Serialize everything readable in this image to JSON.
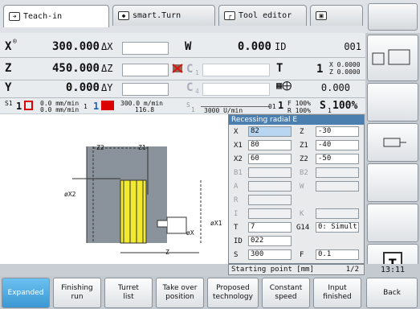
{
  "tabs": [
    {
      "label": "Teach-in",
      "icon": "arrow-right-icon"
    },
    {
      "label": "smart.Turn",
      "icon": "diamond-arrow-icon"
    },
    {
      "label": "Tool editor",
      "icon": "tool-icon"
    },
    {
      "label": "",
      "icon": "floppy-icon"
    }
  ],
  "positions": {
    "x": {
      "axis": "X",
      "value": "300.000",
      "delta": "ΔX"
    },
    "z": {
      "axis": "Z",
      "value": "450.000",
      "delta": "ΔZ"
    },
    "y": {
      "axis": "Y",
      "value": "0.000",
      "delta": "ΔY"
    },
    "w": {
      "axis": "W",
      "value": "0.000",
      "id_label": "ID",
      "id_value": "001"
    },
    "c1": "C",
    "c1_sub": "1",
    "c4": "C",
    "c4_sub": "4",
    "t_label": "T",
    "t_value": "1",
    "t_x": "X 0.0000",
    "t_z": "Z 0.0000",
    "spindle_pos": "0.000"
  },
  "feeds": {
    "s1_label": "S1",
    "s1_num": "1",
    "f1_line1": "0.0 mm/min",
    "f1_line2": "0.0 mm/min",
    "ch_num": "1",
    "ch_num2": "1",
    "f2_line1": "300.0 m/min",
    "f2_line2": "116.8",
    "s_small": "S",
    "s_small_sub": "1",
    "rpm": "3000 U/min",
    "gear": "01",
    "f_pct1": "F 100%",
    "r_pct": "R 100%",
    "s_label": "S",
    "s_sub": "1",
    "s_pct": "100%"
  },
  "dialog": {
    "title": "Recessing radial E",
    "fields": [
      {
        "l1": "X",
        "v1": "82",
        "l2": "Z",
        "v2": "-30"
      },
      {
        "l1": "X1",
        "v1": "80",
        "l2": "Z1",
        "v2": "-40"
      },
      {
        "l1": "X2",
        "v1": "60",
        "l2": "Z2",
        "v2": "-50"
      },
      {
        "l1": "B1",
        "v1": "",
        "l2": "B2",
        "v2": ""
      },
      {
        "l1": "A",
        "v1": "",
        "l2": "W",
        "v2": ""
      },
      {
        "l1": "R",
        "v1": ""
      },
      {
        "l1": "I",
        "v1": "",
        "l2": "K",
        "v2": ""
      },
      {
        "l1": "T",
        "v1": "7",
        "l2": "G14",
        "v2": "0: Simult"
      },
      {
        "l1": "ID",
        "v1": "022"
      },
      {
        "l1": "S",
        "v1": "300",
        "l2": "F",
        "v2": "0.1"
      }
    ],
    "status": "Starting point [mm]",
    "page": "1/2"
  },
  "drawing": {
    "z2": "Z2",
    "z1": "Z1",
    "x2": "øX2",
    "x1": "øX1",
    "x": "øX",
    "z": "Z"
  },
  "softkeys_bottom": [
    {
      "label": "Expanded",
      "selected": true
    },
    {
      "label": "Finishing\nrun",
      "selected": false
    },
    {
      "label": "Turret\nlist",
      "selected": false
    },
    {
      "label": "Take over\nposition",
      "selected": false
    },
    {
      "label": "Proposed\ntechnology",
      "selected": false
    },
    {
      "label": "Constant\nspeed",
      "selected": false
    },
    {
      "label": "Input\nfinished",
      "selected": false
    },
    {
      "label": "Back",
      "selected": false
    }
  ],
  "clock": "13:11",
  "colors": {
    "accent": "#3b98d4",
    "title_bar": "#4a7fb0",
    "workpiece": "#8a939b",
    "tool": "#f2ea2e"
  }
}
